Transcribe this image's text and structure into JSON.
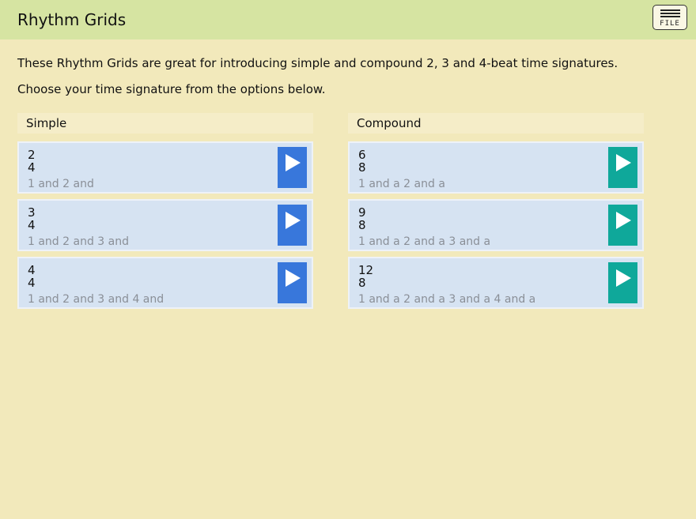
{
  "header": {
    "title": "Rhythm Grids",
    "file_label": "FILE"
  },
  "intro": {
    "line1": "These Rhythm Grids are great for introducing simple and compound 2, 3 and 4-beat time signatures.",
    "line2": "Choose your time signature from the options below."
  },
  "simple": {
    "heading": "Simple",
    "items": [
      {
        "top": "2",
        "bottom": "4",
        "counting": "1 and 2 and"
      },
      {
        "top": "3",
        "bottom": "4",
        "counting": "1 and 2 and 3 and"
      },
      {
        "top": "4",
        "bottom": "4",
        "counting": "1 and 2 and 3 and 4 and"
      }
    ]
  },
  "compound": {
    "heading": "Compound",
    "items": [
      {
        "top": "6",
        "bottom": "8",
        "counting": "1 and a 2 and a"
      },
      {
        "top": "9",
        "bottom": "8",
        "counting": "1 and a 2 and a 3 and a"
      },
      {
        "top": "12",
        "bottom": "8",
        "counting": "1 and a 2 and a 3 and a 4 and a"
      }
    ]
  },
  "icons": {
    "menu": "hamburger-menu-icon",
    "play": "play-icon"
  },
  "colors": {
    "header_bg": "#d6e4a2",
    "page_bg": "#f2e9bb",
    "card_bg": "#d6e3f2",
    "simple_play": "#3877db",
    "compound_play": "#0fa89a"
  }
}
